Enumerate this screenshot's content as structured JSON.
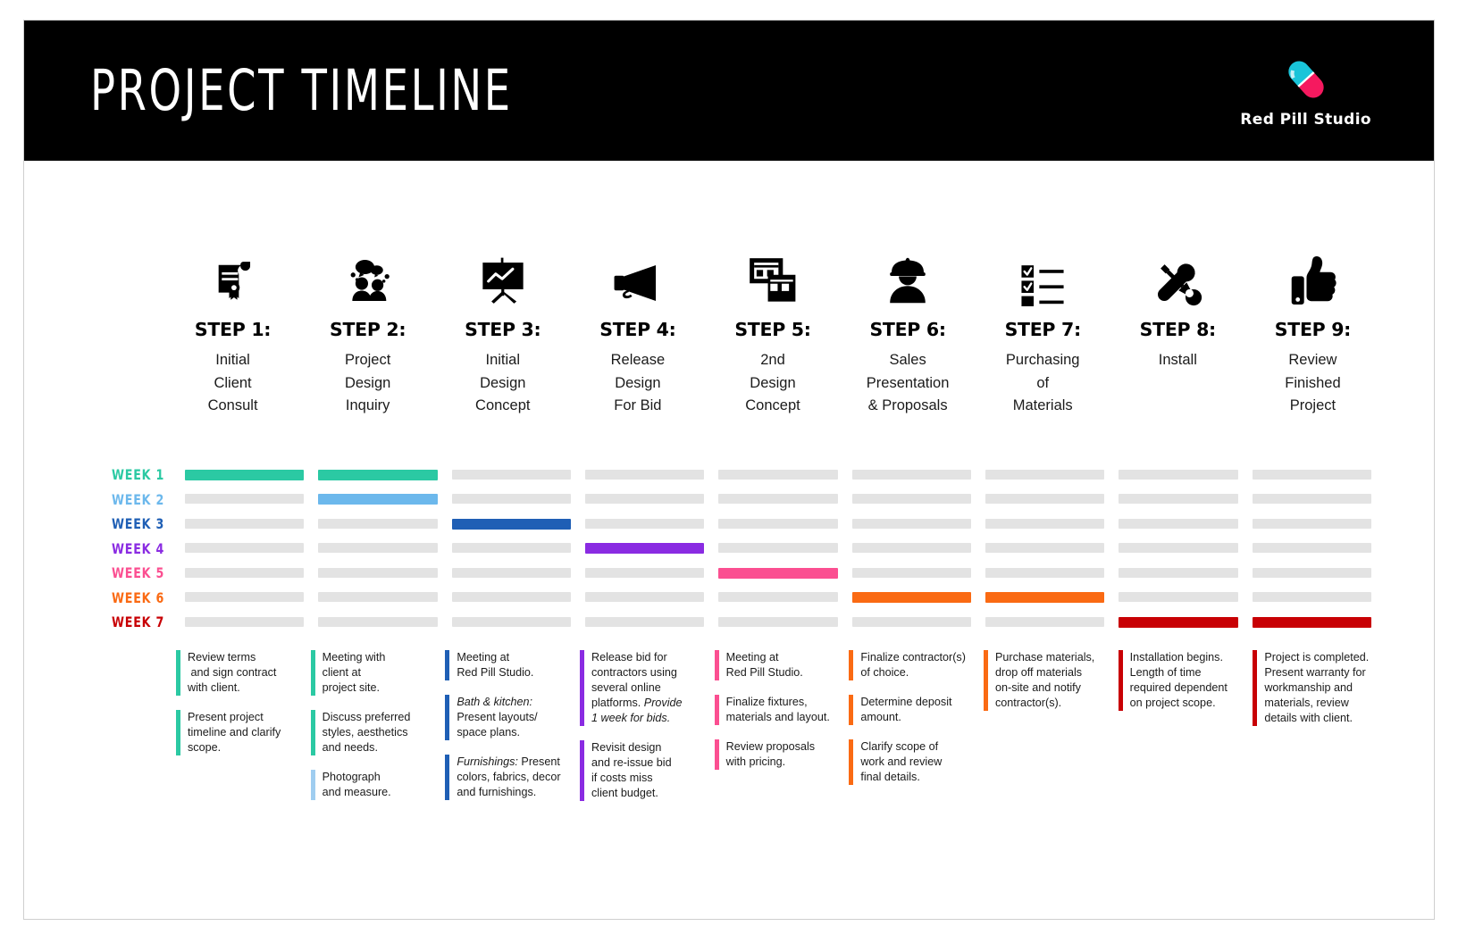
{
  "header": {
    "title": "PROJECT TIMELINE",
    "brand_name": "Red Pill Studio",
    "brand_mark": "pill-capsule-icon",
    "background": "#000000",
    "pill_pink": "#f5195f",
    "pill_cyan": "#19c4d9"
  },
  "palette": {
    "week1": "#2bc9a3",
    "week2": "#6cb8ec",
    "week3": "#1f5fb5",
    "week4": "#8a2be2",
    "week5": "#fb4f91",
    "week6": "#fa6a13",
    "week7": "#c80004",
    "inactive_bar": "#e3e3e3"
  },
  "steps": [
    {
      "icon": "certificate-scroll-icon",
      "title": "STEP 1:",
      "desc": "Initial\nClient\nConsult"
    },
    {
      "icon": "people-discussion-icon",
      "title": "STEP 2:",
      "desc": "Project\nDesign\nInquiry"
    },
    {
      "icon": "presentation-board-icon",
      "title": "STEP 3:",
      "desc": "Initial\nDesign\nConcept"
    },
    {
      "icon": "megaphone-icon",
      "title": "STEP 4:",
      "desc": "Release\nDesign\nFor Bid"
    },
    {
      "icon": "window-panels-icon",
      "title": "STEP 5:",
      "desc": "2nd\nDesign\nConcept"
    },
    {
      "icon": "construction-worker-icon",
      "title": "STEP 6:",
      "desc": "Sales\nPresentation\n& Proposals"
    },
    {
      "icon": "checklist-icon",
      "title": "STEP 7:",
      "desc": "Purchasing\nof\nMaterials"
    },
    {
      "icon": "wrench-screwdriver-icon",
      "title": "STEP 8:",
      "desc": "Install"
    },
    {
      "icon": "thumbs-up-icon",
      "title": "STEP 9:",
      "desc": "Review\nFinished\nProject"
    }
  ],
  "chart_data": {
    "type": "bar",
    "title": "PROJECT TIMELINE",
    "xlabel": "",
    "ylabel": "",
    "grid": false,
    "legend_position": "none",
    "categories": [
      "STEP 1: Initial Client Consult",
      "STEP 2: Project Design Inquiry",
      "STEP 3: Initial Design Concept",
      "STEP 4: Release Design For Bid",
      "STEP 5: 2nd Design Concept",
      "STEP 6: Sales Presentation & Proposals",
      "STEP 7: Purchasing of Materials",
      "STEP 8: Install",
      "STEP 9: Review Finished Project"
    ],
    "rows": [
      {
        "label": "WEEK 1",
        "color": "#2bc9a3",
        "active_steps": [
          1,
          2
        ]
      },
      {
        "label": "WEEK 2",
        "color": "#6cb8ec",
        "active_steps": [
          2
        ]
      },
      {
        "label": "WEEK 3",
        "color": "#1f5fb5",
        "active_steps": [
          3
        ]
      },
      {
        "label": "WEEK 4",
        "color": "#8a2be2",
        "active_steps": [
          4
        ]
      },
      {
        "label": "WEEK 5",
        "color": "#fb4f91",
        "active_steps": [
          5
        ]
      },
      {
        "label": "WEEK 6",
        "color": "#fa6a13",
        "active_steps": [
          6,
          7
        ]
      },
      {
        "label": "WEEK 7",
        "color": "#c80004",
        "active_steps": [
          8,
          9
        ]
      }
    ]
  },
  "notes": [
    {
      "color": "#2bc9a3",
      "items": [
        "Review terms<br>&nbsp;and sign contract<br>with client.",
        "Present project<br>timeline and clarify<br>scope."
      ]
    },
    {
      "color": "#2bc9a3",
      "items": [
        "Meeting with<br>client at<br>project site.",
        "Discuss preferred<br>styles, aesthetics<br>and needs."
      ],
      "extra": {
        "color": "#9fcdf0",
        "text": "Photograph<br>and measure."
      }
    },
    {
      "color": "#1f5fb5",
      "items": [
        "Meeting at<br>Red Pill Studio.",
        "<em>Bath &amp; kitchen:</em><br>Present layouts/<br>space plans.",
        "<em>Furnishings:</em> Present<br>colors, fabrics, decor<br>and furnishings."
      ]
    },
    {
      "color": "#8a2be2",
      "items": [
        "Release bid for<br>contractors using<br>several online<br>platforms. <em>Provide<br>1 week for bids.</em>",
        "Revisit design<br>and re-issue bid<br>if costs miss<br>client budget."
      ]
    },
    {
      "color": "#fb4f91",
      "items": [
        "Meeting at<br>Red Pill Studio.",
        "Finalize fixtures,<br>materials and layout.",
        "Review proposals<br>with pricing."
      ]
    },
    {
      "color": "#fa6a13",
      "items": [
        "Finalize contractor(s)<br>of choice.",
        "Determine deposit<br>amount.",
        "Clarify scope of<br>work and review<br>final details."
      ]
    },
    {
      "color": "#fa6a13",
      "items": [
        "Purchase materials,<br>drop off materials<br>on-site and notify<br>contractor(s)."
      ]
    },
    {
      "color": "#c80004",
      "items": [
        "Installation begins.<br>Length of time<br>required dependent<br>on project scope."
      ]
    },
    {
      "color": "#c80004",
      "items": [
        "Project is completed.<br>Present warranty for<br>workmanship and<br>materials, review<br>details with client."
      ]
    }
  ]
}
